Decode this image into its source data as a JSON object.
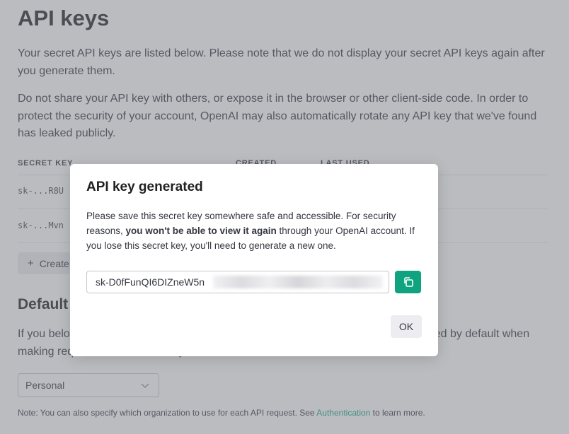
{
  "page": {
    "title": "API keys",
    "intro": "Your secret API keys are listed below. Please note that we do not display your secret API keys again after you generate them.",
    "warning": "Do not share your API key with others, or expose it in the browser or other client-side code. In order to protect the security of your account, OpenAI may also automatically rotate any API key that we've found has leaked publicly."
  },
  "keys_table": {
    "columns": [
      "SECRET KEY",
      "CREATED",
      "LAST USED"
    ],
    "rows": [
      {
        "key": "sk-...R8U"
      },
      {
        "key": "sk-...Mvn"
      }
    ],
    "create_label": "Create new secret key"
  },
  "default_org": {
    "heading": "Default organization",
    "description": "If you belong to multiple organizations, this setting controls which organization is used by default when making requests with the API keys above.",
    "selected": "Personal"
  },
  "note": {
    "prefix": "Note: You can also specify which organization to use for each API request. See ",
    "link": "Authentication",
    "suffix": " to learn more."
  },
  "modal": {
    "title": "API key generated",
    "body_1": "Please save this secret key somewhere safe and accessible. For security reasons, ",
    "body_bold": "you won't be able to view it again",
    "body_2": " through your OpenAI account. If you lose this secret key, you'll need to generate a new one.",
    "key_value": "sk-D0fFunQI6DIZneW5n",
    "ok_label": "OK"
  },
  "colors": {
    "accent": "#10a37f",
    "overlay": "#787a82"
  },
  "icons": {
    "copy": "copy-icon",
    "plus": "plus-icon",
    "chevron": "chevron-down-icon"
  }
}
